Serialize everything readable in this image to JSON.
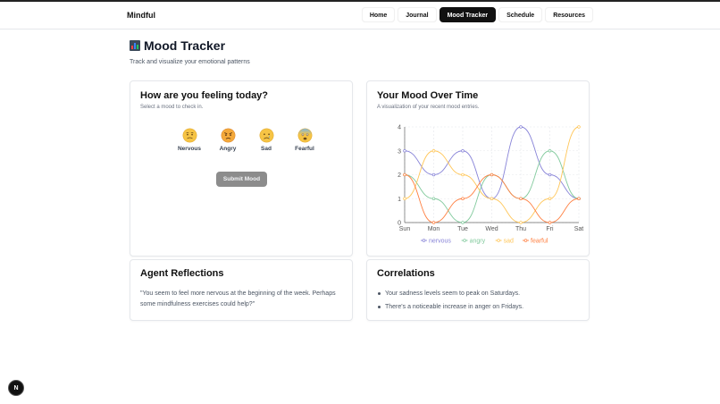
{
  "header": {
    "brand": "Mindful",
    "nav": [
      {
        "label": "Home",
        "active": false
      },
      {
        "label": "Journal",
        "active": false
      },
      {
        "label": "Mood Tracker",
        "active": true
      },
      {
        "label": "Schedule",
        "active": false
      },
      {
        "label": "Resources",
        "active": false
      }
    ]
  },
  "page": {
    "title": "Mood Tracker",
    "subtitle": "Track and visualize your emotional patterns"
  },
  "checkin": {
    "title": "How are you feeling today?",
    "description": "Select a mood to check in.",
    "moods": [
      {
        "label": "Nervous",
        "icon": "nervous-face-icon"
      },
      {
        "label": "Angry",
        "icon": "angry-face-icon"
      },
      {
        "label": "Sad",
        "icon": "sad-face-icon"
      },
      {
        "label": "Fearful",
        "icon": "fearful-face-icon"
      }
    ],
    "submit_label": "Submit Mood"
  },
  "mood_chart": {
    "title": "Your Mood Over Time",
    "description": "A visualization of your recent mood entries."
  },
  "reflections": {
    "title": "Agent Reflections",
    "text": "\"You seem to feel more nervous at the beginning of the week. Perhaps some mindfulness exercises could help?\""
  },
  "correlations": {
    "title": "Correlations",
    "items": [
      "Your sadness levels seem to peak on Saturdays.",
      "There's a noticeable increase in anger on Fridays."
    ]
  },
  "badge": {
    "label": "N"
  },
  "colors": {
    "nervous": "#8884d8",
    "angry": "#82ca9d",
    "sad": "#ffc658",
    "fearful": "#ff8042",
    "active_nav": "#111111"
  },
  "chart_data": {
    "type": "line",
    "x": [
      "Sun",
      "Mon",
      "Tue",
      "Wed",
      "Thu",
      "Fri",
      "Sat"
    ],
    "ylim": [
      0,
      4
    ],
    "yticks": [
      0,
      1,
      2,
      3,
      4
    ],
    "grid": true,
    "legend_position": "bottom",
    "series": [
      {
        "name": "nervous",
        "color": "#8884d8",
        "values": [
          3,
          2,
          3,
          1,
          4,
          2,
          1
        ]
      },
      {
        "name": "angry",
        "color": "#82ca9d",
        "values": [
          2,
          1,
          0,
          2,
          1,
          3,
          1
        ]
      },
      {
        "name": "sad",
        "color": "#ffc658",
        "values": [
          1,
          3,
          2,
          1,
          0,
          1,
          4
        ]
      },
      {
        "name": "fearful",
        "color": "#ff8042",
        "values": [
          2,
          0,
          1,
          2,
          1,
          0,
          1
        ]
      }
    ]
  }
}
